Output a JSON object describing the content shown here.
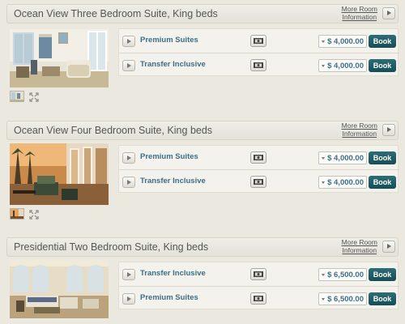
{
  "more_info": {
    "line1": "More Room",
    "line2": "Information"
  },
  "book_label": "Book",
  "rooms": [
    {
      "title": "Ocean View Three Bedroom Suite, King beds",
      "rates": [
        {
          "name": "Premium Suites",
          "price": "$ 4,000.00"
        },
        {
          "name": "Transfer Inclusive",
          "price": "$ 4,000.00"
        }
      ]
    },
    {
      "title": "Ocean View Four Bedroom Suite, King beds",
      "rates": [
        {
          "name": "Premium Suites",
          "price": "$ 4,000.00"
        },
        {
          "name": "Transfer Inclusive",
          "price": "$ 4,000.00"
        }
      ]
    },
    {
      "title": "Presidential Two Bedroom Suite, King beds",
      "rates": [
        {
          "name": "Transfer Inclusive",
          "price": "$ 6,500.00"
        },
        {
          "name": "Premium Suites",
          "price": "$ 6,500.00"
        }
      ]
    }
  ],
  "icons": {
    "play": "play-icon",
    "cash": "cash-icon",
    "expand": "expand-icon",
    "dropdown": "chevron-down-icon"
  },
  "colors": {
    "page_bg": "#ebe8df",
    "header_bg": "#e8e6de",
    "rate_link": "#3d6f86",
    "book_button": "#1f5a63"
  }
}
